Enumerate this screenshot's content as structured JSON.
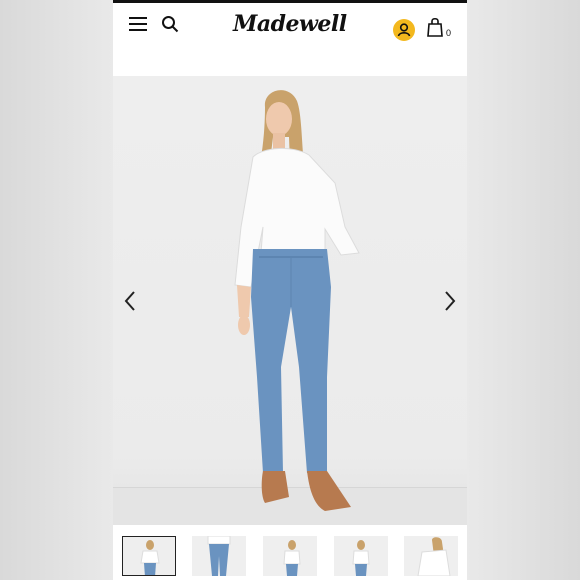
{
  "header": {
    "logo_text": "Madewell",
    "bag_count": "0",
    "account_color": "#f3b81e"
  },
  "icons": {
    "menu": "hamburger-menu-icon",
    "search": "search-icon",
    "account": "user-icon",
    "bag": "shopping-bag-icon",
    "prev": "chevron-left-icon",
    "next": "chevron-right-icon"
  },
  "gallery": {
    "image_count": 5,
    "active_index": 0
  }
}
